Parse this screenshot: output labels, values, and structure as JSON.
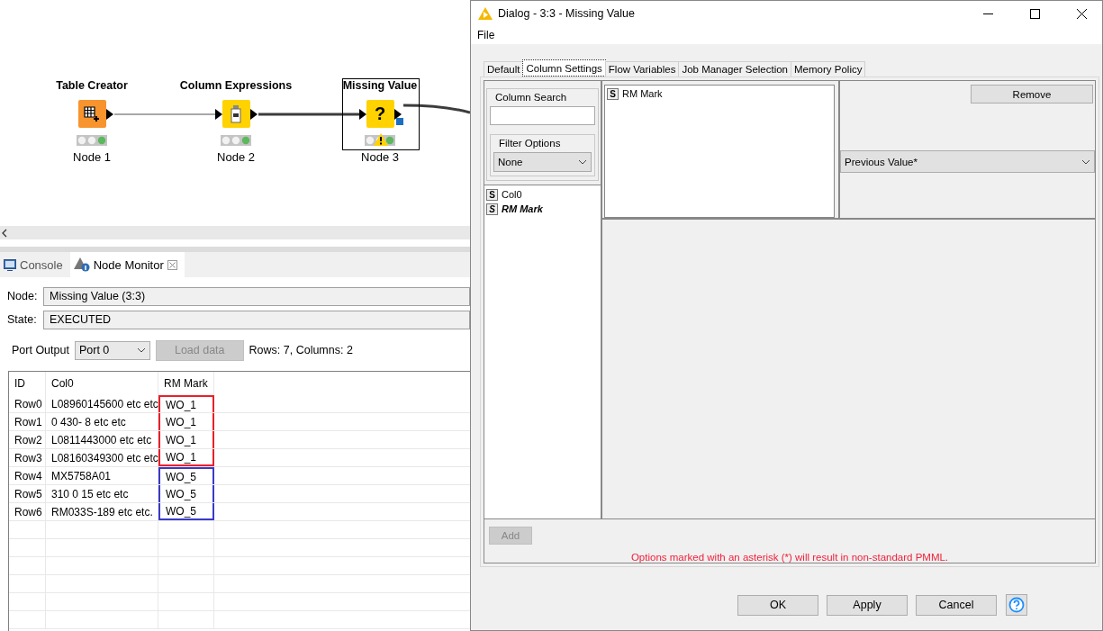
{
  "workflow": {
    "nodes": [
      {
        "title": "Table Creator",
        "label": "Node 1",
        "kind": "source",
        "color": "#f7942e",
        "executed": true,
        "selected": false,
        "warning": false
      },
      {
        "title": "Column Expressions",
        "label": "Node 2",
        "kind": "expressions",
        "color": "#ffd200",
        "executed": true,
        "selected": false,
        "warning": false
      },
      {
        "title": "Missing Value",
        "label": "Node 3",
        "kind": "missing",
        "color": "#ffd200",
        "executed": true,
        "selected": true,
        "warning": true,
        "symbol": "?"
      }
    ]
  },
  "bottom_panel": {
    "tabs": [
      {
        "label": "Console",
        "kind": "console",
        "selected": false
      },
      {
        "label": "Node Monitor",
        "kind": "monitor",
        "selected": true
      }
    ],
    "node_label": "Node:",
    "node_value": "Missing Value  (3:3)",
    "state_label": "State:",
    "state_value": "EXECUTED",
    "port_label": "Port Output",
    "port_value": "Port 0",
    "load_button": {
      "label": "Load data",
      "disabled": true
    },
    "summary": "Rows: 7, Columns: 2",
    "table": {
      "columns": [
        "ID",
        "Col0",
        "RM Mark"
      ],
      "rows": [
        {
          "cells": [
            "Row0",
            "L08960145600 etc etc",
            "WO_1"
          ],
          "color": "#e8202a"
        },
        {
          "cells": [
            "Row1",
            "0 430- 8 etc etc",
            "WO_1"
          ],
          "color": "#e8202a"
        },
        {
          "cells": [
            "Row2",
            "L0811443000 etc etc",
            "WO_1"
          ],
          "color": "#e8202a"
        },
        {
          "cells": [
            "Row3",
            "L08160349300 etc etc",
            "WO_1"
          ],
          "color": "#e8202a"
        },
        {
          "cells": [
            "Row4",
            "MX5758A01",
            "WO_5"
          ],
          "color": "#3a3ac8"
        },
        {
          "cells": [
            "Row5",
            "310 0 15 etc etc",
            "WO_5"
          ],
          "color": "#3a3ac8"
        },
        {
          "cells": [
            "Row6",
            "RM033S-189 etc etc.",
            "WO_5"
          ],
          "color": "#3a3ac8"
        }
      ]
    }
  },
  "dialog": {
    "title": "Dialog - 3:3 - Missing Value",
    "menu": [
      "File"
    ],
    "tabs": [
      {
        "label": "Default",
        "selected": false
      },
      {
        "label": "Column Settings",
        "selected": true
      },
      {
        "label": "Flow Variables",
        "selected": false
      },
      {
        "label": "Job Manager Selection",
        "selected": false
      },
      {
        "label": "Memory Policy",
        "selected": false
      }
    ],
    "column_search": {
      "legend": "Column Search"
    },
    "filter_options": {
      "legend": "Filter Options",
      "value": "None"
    },
    "columns": [
      {
        "type": "S",
        "name": "Col0",
        "configured": false
      },
      {
        "type": "S",
        "name": "RM Mark",
        "configured": true
      }
    ],
    "selected_columns": [
      {
        "type": "S",
        "name": "RM Mark"
      }
    ],
    "remove_button": "Remove",
    "method": "Previous Value*",
    "add_button": {
      "label": "Add",
      "disabled": true
    },
    "note": "Options marked with an asterisk (*) will result in non-standard PMML.",
    "buttons": [
      "OK",
      "Apply",
      "Cancel"
    ]
  }
}
